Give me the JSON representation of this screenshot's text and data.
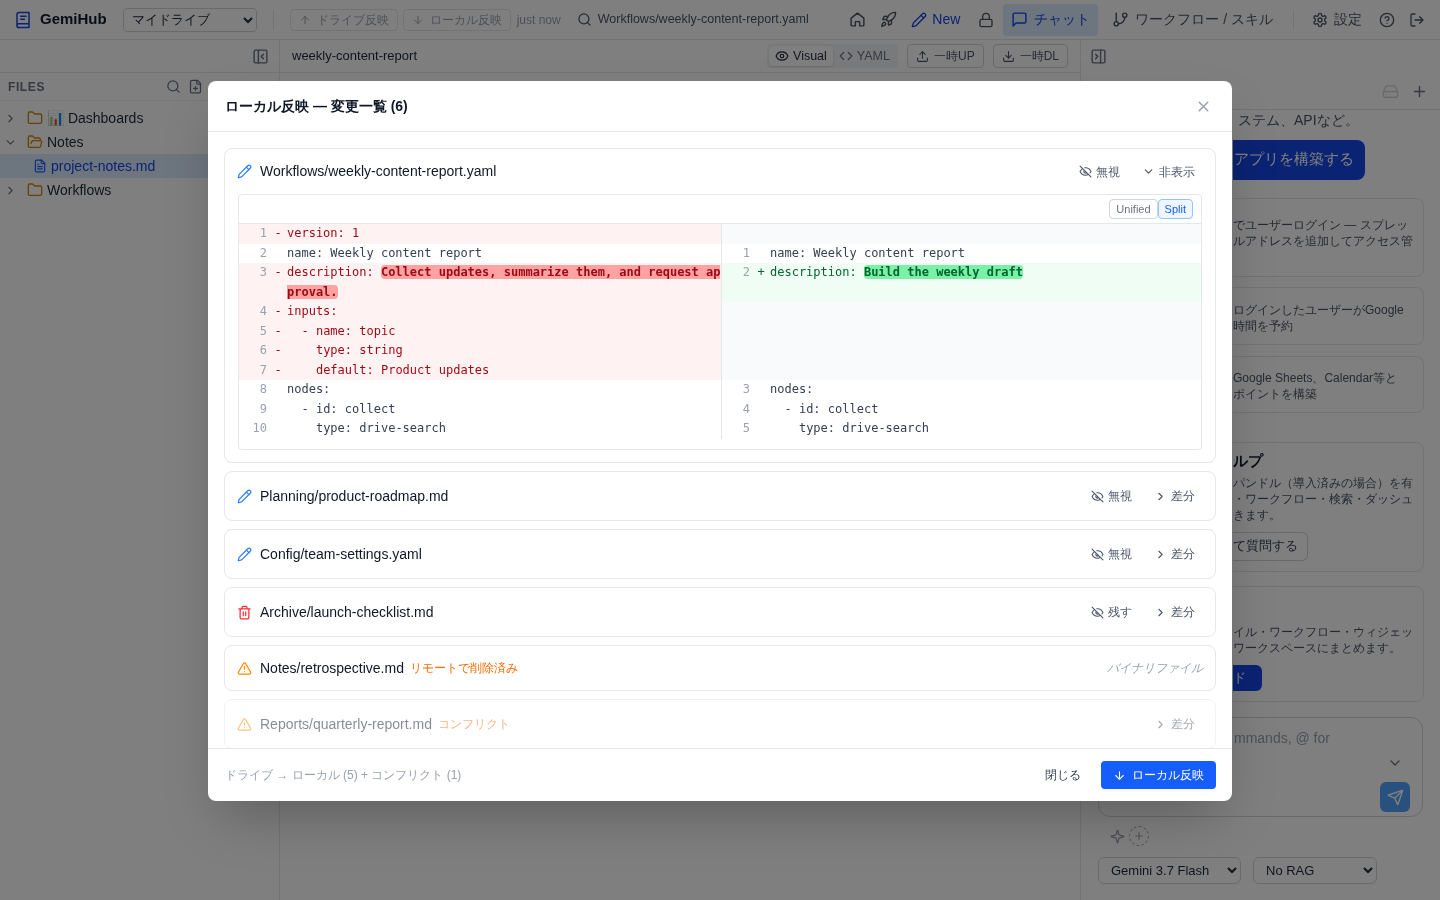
{
  "app": {
    "name": "GemiHub",
    "drive_select": "マイドライブ",
    "sync_buttons": [
      {
        "label": "ドライブ反映",
        "kind": "push",
        "disabled": true
      },
      {
        "label": "ローカル反映",
        "kind": "pull",
        "disabled": true
      }
    ],
    "sync_time": "just now",
    "open_file": "Workflows/weekly-content-report.yaml",
    "new_label": "New",
    "nav_tabs": [
      {
        "label": "チャット",
        "kind": "chat",
        "selected": true
      },
      {
        "label": "ワークフロー / スキル",
        "kind": "workflow",
        "selected": false
      }
    ],
    "settings_label": "設定"
  },
  "sidebar": {
    "title": "FILES",
    "tree": [
      {
        "name": "📊 Dashboards",
        "kind": "folder",
        "expanded": false,
        "selected": false
      },
      {
        "name": "Notes",
        "kind": "folder",
        "expanded": true,
        "selected": false,
        "children": [
          {
            "name": "project-notes.md",
            "kind": "file",
            "selected": true
          }
        ]
      },
      {
        "name": "Workflows",
        "kind": "folder",
        "expanded": false,
        "selected": false
      }
    ]
  },
  "editor": {
    "title": "weekly-content-report",
    "view_modes": [
      {
        "label": "Visual",
        "kind": "visual",
        "selected": true
      },
      {
        "label": "YAML",
        "kind": "yaml",
        "selected": false
      }
    ],
    "actions": [
      {
        "label": "一時UP",
        "kind": "upload"
      },
      {
        "label": "一時DL",
        "kind": "download"
      }
    ]
  },
  "chat": {
    "intro": "ステム、APIなど。",
    "build_button": "アプリを構築する",
    "cards": [
      {
        "lines": [
          "でユーザーログイン — スプレッ",
          "ルアドレスを追加してアクセス管"
        ]
      },
      {
        "lines": [
          "ログインしたユーザーがGoogle",
          "時間を予約"
        ]
      },
      {
        "lines": [
          "Google Sheets、Calendar等と",
          "ポイントを構築"
        ]
      },
      {
        "title": "ルプ",
        "lines": [
          "パンドル（導入済みの場合）を有",
          "・ワークフロー・検索・ダッシュ",
          "きます。"
        ],
        "button": {
          "label": "て質問する",
          "kind": "secondary"
        }
      },
      {
        "lines": [
          "イル・ワークフロー・ウィジェッ",
          "ワークスペースにまとめます。"
        ],
        "button": {
          "label": "ド",
          "kind": "primary"
        }
      }
    ],
    "placeholder": "mmands, @ for",
    "model": "Gemini 3.7 Flash",
    "rag": "No RAG"
  },
  "modal": {
    "title": "ローカル反映 — 変更一覧 (6)",
    "items": [
      {
        "kind": "modified",
        "path": "Workflows/weekly-content-report.yaml",
        "expanded": true,
        "disabled": false,
        "actions": [
          {
            "label": "無視",
            "kind": "ignore"
          },
          {
            "label": "非表示",
            "kind": "collapse"
          }
        ],
        "diff": {
          "modes": [
            {
              "label": "Unified",
              "selected": false
            },
            {
              "label": "Split",
              "selected": true
            }
          ],
          "rows": [
            {
              "left": {
                "num": "1",
                "sign": "-",
                "kind": "del",
                "text": "version: 1"
              }
            },
            {
              "left": {
                "num": "2",
                "kind": "ctx",
                "text": "name: Weekly content report"
              },
              "right": {
                "num": "1",
                "kind": "ctx",
                "text": "name: Weekly content report"
              }
            },
            {
              "left": {
                "num": "3",
                "sign": "-",
                "kind": "del",
                "text": "description: ",
                "changed": "Collect updates, summarize them, and request approval."
              },
              "right": {
                "num": "2",
                "sign": "+",
                "kind": "add",
                "text": "description: ",
                "changed": "Build the weekly draft"
              }
            },
            {
              "left": {
                "num": "4",
                "sign": "-",
                "kind": "del",
                "text": "inputs:"
              }
            },
            {
              "left": {
                "num": "5",
                "sign": "-",
                "kind": "del",
                "text": "  - name: topic"
              }
            },
            {
              "left": {
                "num": "6",
                "sign": "-",
                "kind": "del",
                "text": "    type: string"
              }
            },
            {
              "left": {
                "num": "7",
                "sign": "-",
                "kind": "del",
                "text": "    default: Product updates"
              }
            },
            {
              "left": {
                "num": "8",
                "kind": "ctx",
                "text": "nodes:"
              },
              "right": {
                "num": "3",
                "kind": "ctx",
                "text": "nodes:"
              }
            },
            {
              "left": {
                "num": "9",
                "kind": "ctx",
                "text": "  - id: collect"
              },
              "right": {
                "num": "4",
                "kind": "ctx",
                "text": "  - id: collect"
              }
            },
            {
              "left": {
                "num": "10",
                "kind": "ctx",
                "text": "    type: drive-search"
              },
              "right": {
                "num": "5",
                "kind": "ctx",
                "text": "    type: drive-search"
              }
            }
          ]
        }
      },
      {
        "kind": "modified",
        "path": "Planning/product-roadmap.md",
        "expanded": false,
        "disabled": false,
        "actions": [
          {
            "label": "無視",
            "kind": "ignore"
          },
          {
            "label": "差分",
            "kind": "expand"
          }
        ]
      },
      {
        "kind": "modified",
        "path": "Config/team-settings.yaml",
        "expanded": false,
        "disabled": false,
        "actions": [
          {
            "label": "無視",
            "kind": "ignore"
          },
          {
            "label": "差分",
            "kind": "expand"
          }
        ]
      },
      {
        "kind": "deleted",
        "path": "Archive/launch-checklist.md",
        "expanded": false,
        "disabled": false,
        "actions": [
          {
            "label": "残す",
            "kind": "keep"
          },
          {
            "label": "差分",
            "kind": "expand"
          }
        ]
      },
      {
        "kind": "remote_deleted",
        "path": "Notes/retrospective.md",
        "tag": "リモートで削除済み",
        "note": "バイナリファイル",
        "expanded": false,
        "disabled": false
      },
      {
        "kind": "conflict",
        "path": "Reports/quarterly-report.md",
        "tag": "コンフリクト",
        "expanded": false,
        "disabled": true,
        "actions": [
          {
            "label": "差分",
            "kind": "expand"
          }
        ]
      }
    ],
    "summary": "ドライブ → ローカル (5) + コンフリクト (1)",
    "close_label": "閉じる",
    "apply_label": "ローカル反映"
  }
}
